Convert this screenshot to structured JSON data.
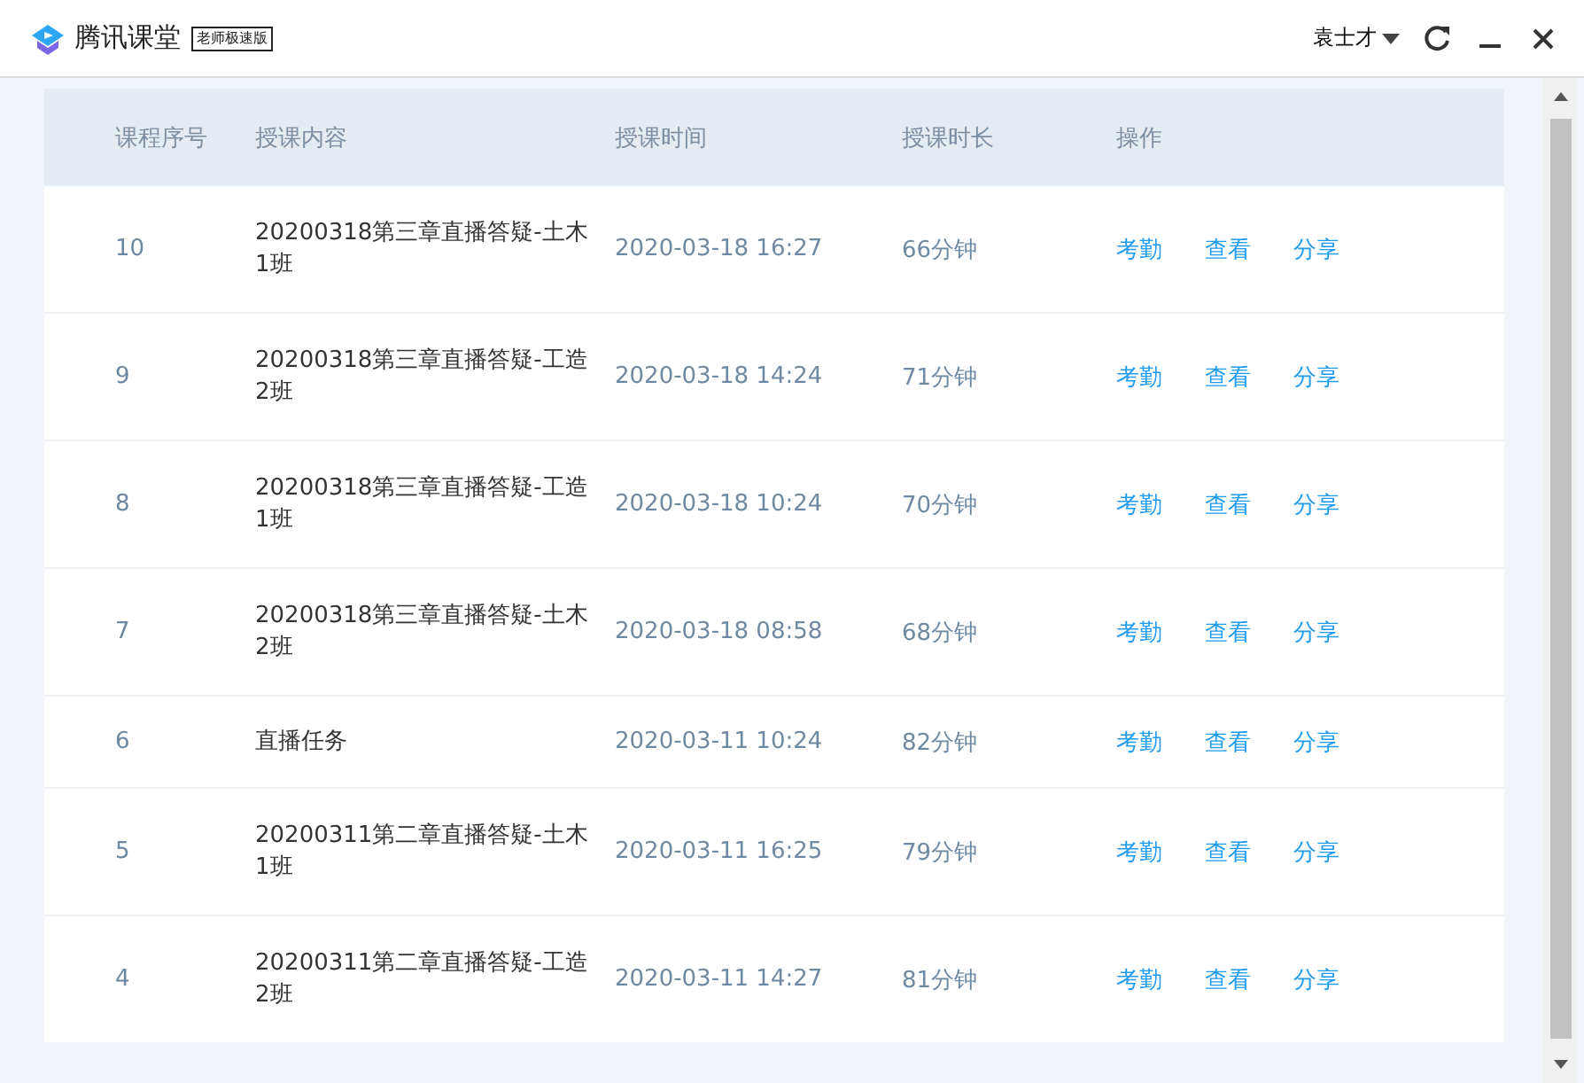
{
  "window": {
    "app_name": "腾讯课堂",
    "edition_badge": "老师极速版",
    "user_name": "袁士才"
  },
  "table": {
    "columns": [
      "课程序号",
      "授课内容",
      "授课时间",
      "授课时长",
      "操作"
    ],
    "rows": [
      {
        "number": "10",
        "content": "20200318第三章直播答疑-土木1班",
        "time": "2020-03-18 16:27",
        "duration": "66分钟",
        "actions": [
          "考勤",
          "查看",
          "分享"
        ]
      },
      {
        "number": "9",
        "content": "20200318第三章直播答疑-工造2班",
        "time": "2020-03-18 14:24",
        "duration": "71分钟",
        "actions": [
          "考勤",
          "查看",
          "分享"
        ]
      },
      {
        "number": "8",
        "content": "20200318第三章直播答疑-工造1班",
        "time": "2020-03-18 10:24",
        "duration": "70分钟",
        "actions": [
          "考勤",
          "查看",
          "分享"
        ]
      },
      {
        "number": "7",
        "content": "20200318第三章直播答疑-土木2班",
        "time": "2020-03-18 08:58",
        "duration": "68分钟",
        "actions": [
          "考勤",
          "查看",
          "分享"
        ]
      },
      {
        "number": "6",
        "content": "直播任务",
        "time": "2020-03-11 10:24",
        "duration": "82分钟",
        "actions": [
          "考勤",
          "查看",
          "分享"
        ]
      },
      {
        "number": "5",
        "content": "20200311第二章直播答疑-土木1班",
        "time": "2020-03-11 16:25",
        "duration": "79分钟",
        "actions": [
          "考勤",
          "查看",
          "分享"
        ]
      },
      {
        "number": "4",
        "content": "20200311第二章直播答疑-工造2班",
        "time": "2020-03-11 14:27",
        "duration": "81分钟",
        "actions": [
          "考勤",
          "查看",
          "分享"
        ]
      }
    ]
  }
}
